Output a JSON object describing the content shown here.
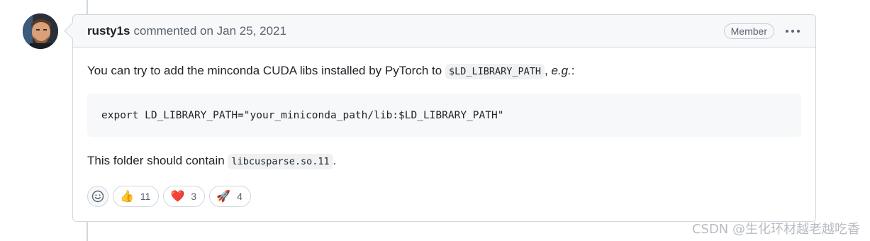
{
  "comment": {
    "author": "rusty1s",
    "meta": "commented on Jan 25, 2021",
    "role_badge": "Member",
    "body": {
      "p1_text": "You can try to add the minconda CUDA libs installed by PyTorch to",
      "p1_code": "$LD_LIBRARY_PATH",
      "p1_sep": ", ",
      "p1_em": "e.g.",
      "p1_end": ":",
      "code_block": "export LD_LIBRARY_PATH=\"your_miniconda_path/lib:$LD_LIBRARY_PATH\"",
      "p2_text": "This folder should contain",
      "p2_code": "libcusparse.so.11",
      "p2_end": "."
    },
    "reactions": [
      {
        "emoji": "👍",
        "icon": "thumbs-up-icon",
        "count": "11"
      },
      {
        "emoji": "❤️",
        "icon": "heart-icon",
        "count": "3"
      },
      {
        "emoji": "🚀",
        "icon": "rocket-icon",
        "count": "4"
      }
    ]
  },
  "watermark": "CSDN @生化环材越老越吃香",
  "colors": {
    "border": "#d0d7de",
    "header_bg": "#f6f8fa",
    "muted_text": "#59636e"
  }
}
